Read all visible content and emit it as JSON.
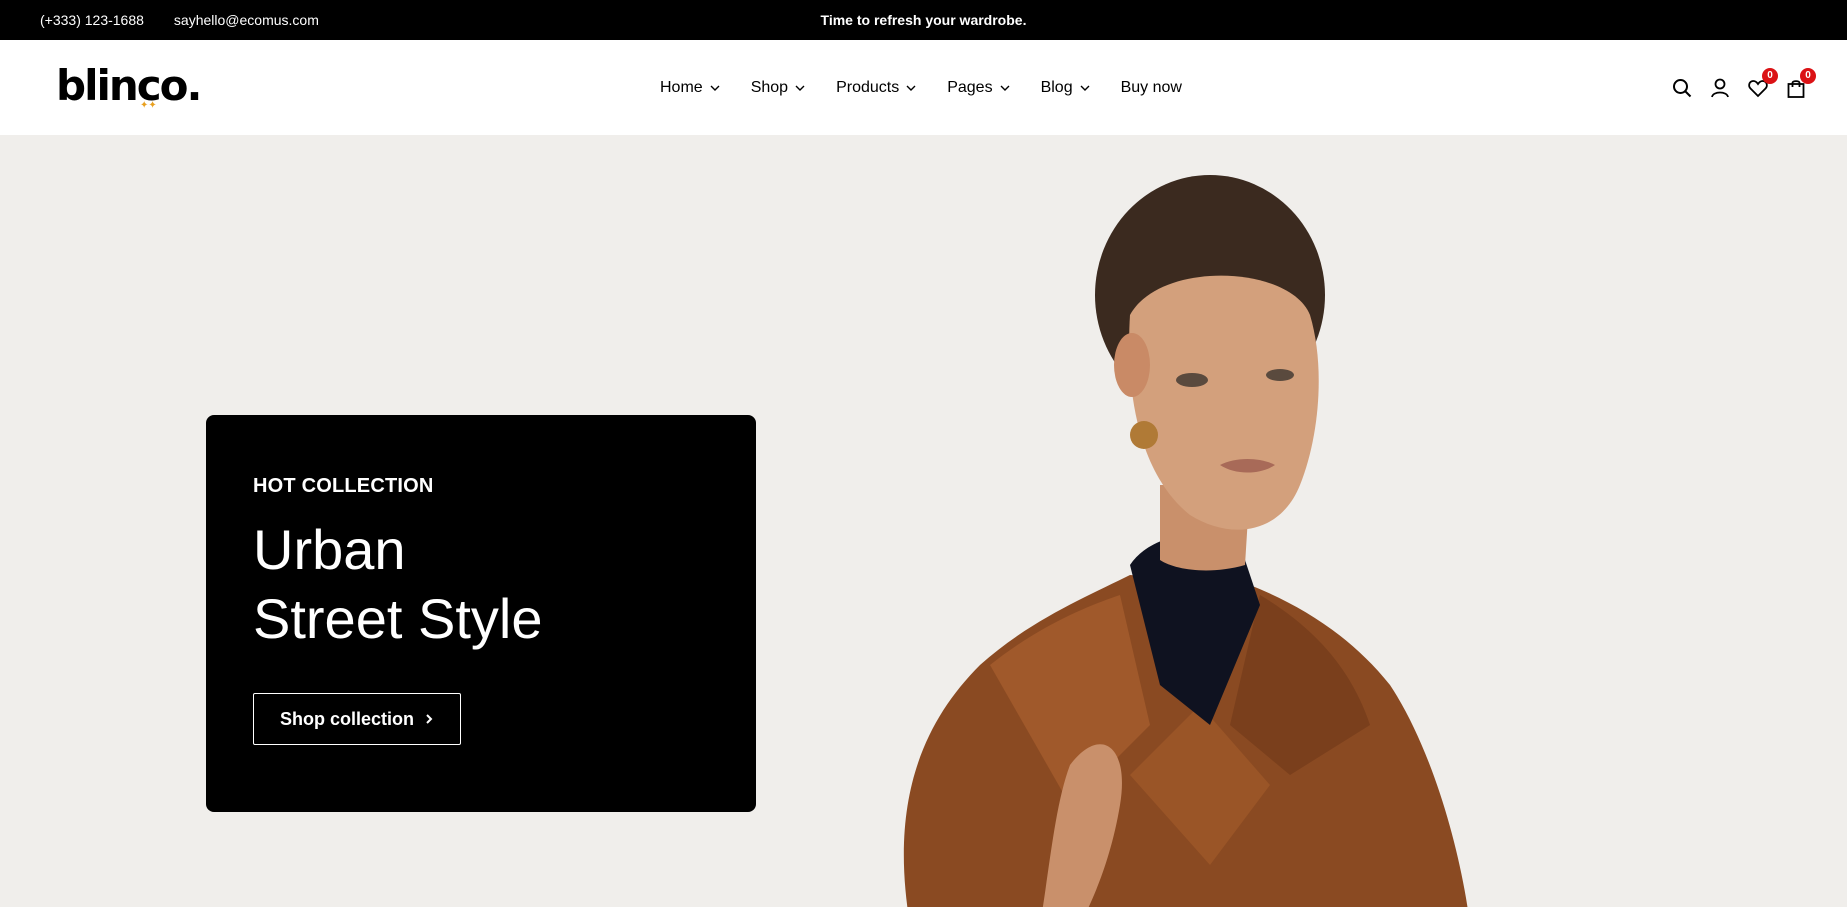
{
  "topbar": {
    "phone": "(+333) 123-1688",
    "email": "sayhello@ecomus.com",
    "promo": "Time to refresh your wardrobe."
  },
  "header": {
    "logo": "blinco.",
    "nav": [
      {
        "label": "Home",
        "has_dropdown": true
      },
      {
        "label": "Shop",
        "has_dropdown": true
      },
      {
        "label": "Products",
        "has_dropdown": true
      },
      {
        "label": "Pages",
        "has_dropdown": true
      },
      {
        "label": "Blog",
        "has_dropdown": true
      },
      {
        "label": "Buy now",
        "has_dropdown": false
      }
    ],
    "icons": {
      "search": "search-icon",
      "account": "user-icon",
      "wishlist": "heart-icon",
      "cart": "bag-icon"
    },
    "wishlist_count": "0",
    "cart_count": "0"
  },
  "hero": {
    "subtitle": "HOT COLLECTION",
    "title_line1": "Urban",
    "title_line2": "Street Style",
    "cta_label": "Shop collection",
    "cta_icon": "chevron-right-icon",
    "image": "model-in-brown-leather-jacket"
  },
  "colors": {
    "topbar_bg": "#000000",
    "hero_bg": "#f0eeeb",
    "card_bg": "#000000",
    "badge": "#db1215",
    "jacket": "#8a4a22"
  }
}
